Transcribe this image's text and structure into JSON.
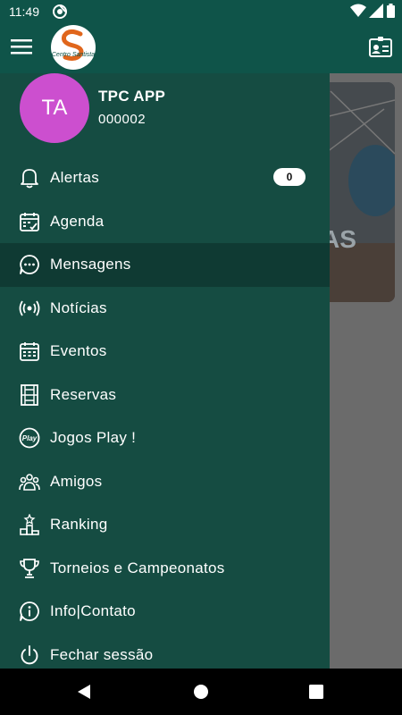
{
  "status_bar": {
    "time": "11:49"
  },
  "app_bar": {
    "menu_icon": "hamburger-icon",
    "logo_text": "Centro Santista",
    "profile_icon": "id-card-icon"
  },
  "background": {
    "card_text": "AS"
  },
  "drawer": {
    "avatar_initials": "TA",
    "avatar_color": "#cc4fcf",
    "user_name": "TPC APP",
    "user_id": "000002",
    "items": [
      {
        "label": "Alertas",
        "icon": "bell-icon",
        "badge": "0"
      },
      {
        "label": "Agenda",
        "icon": "calendar-check-icon"
      },
      {
        "label": "Mensagens",
        "icon": "chat-bubble-icon",
        "active": true
      },
      {
        "label": "Notícias",
        "icon": "broadcast-icon"
      },
      {
        "label": "Eventos",
        "icon": "calendar-grid-icon"
      },
      {
        "label": "Reservas",
        "icon": "court-icon"
      },
      {
        "label": "Jogos Play !",
        "icon": "play-logo-icon"
      },
      {
        "label": "Amigos",
        "icon": "people-group-icon"
      },
      {
        "label": "Ranking",
        "icon": "podium-icon"
      },
      {
        "label": "Torneios e Campeonatos",
        "icon": "trophy-icon"
      },
      {
        "label": "Info|Contato",
        "icon": "info-icon"
      },
      {
        "label": "Fechar sessão",
        "icon": "power-icon"
      }
    ]
  },
  "colors": {
    "primary": "#0f5449",
    "drawer": "#154c42",
    "active_item": "#0f3a33"
  }
}
